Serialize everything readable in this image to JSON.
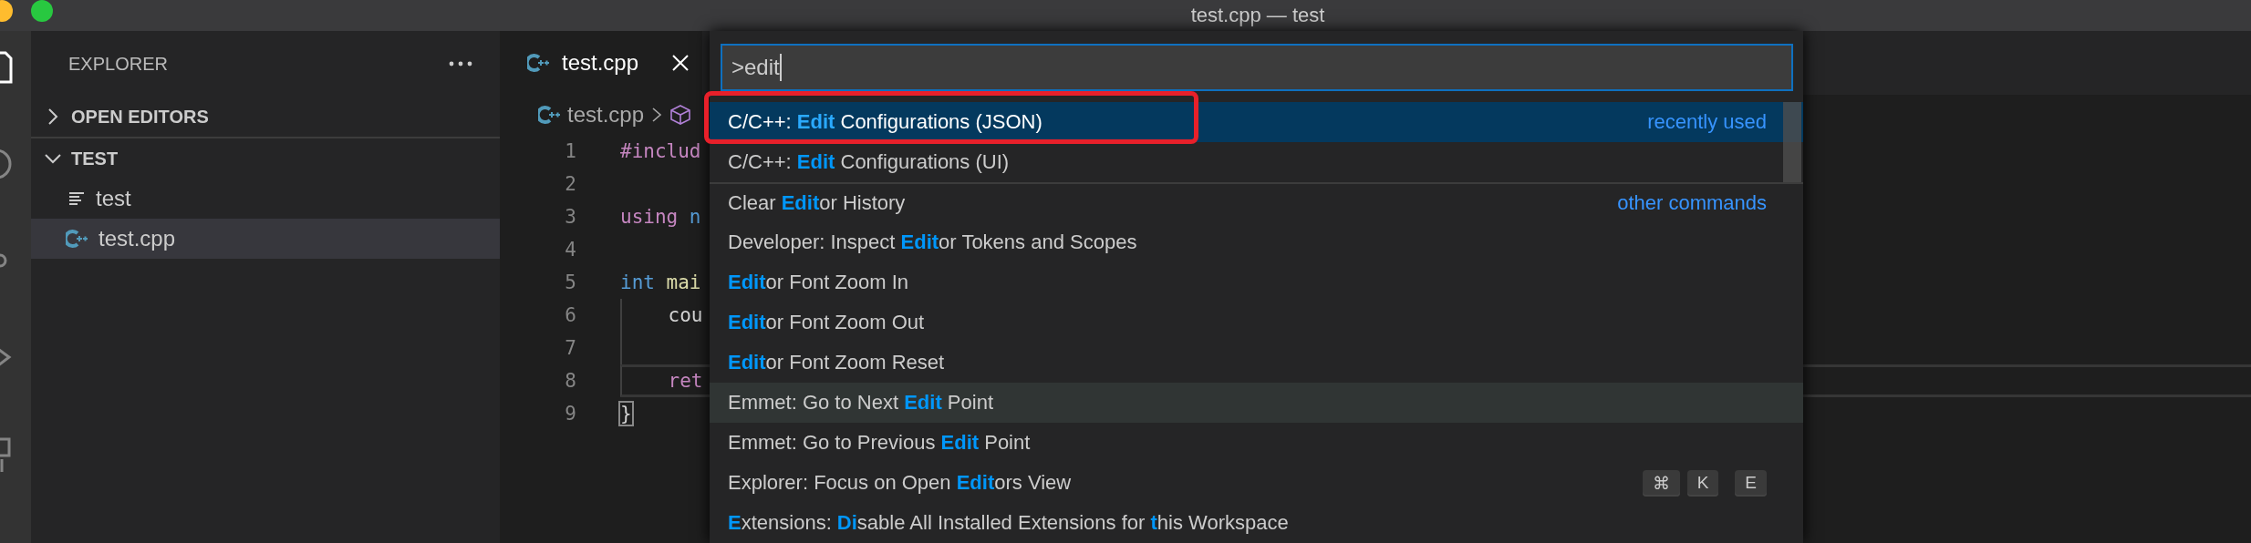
{
  "window": {
    "title": "test.cpp — test"
  },
  "sidebar": {
    "title": "EXPLORER",
    "sections": [
      {
        "label": "OPEN EDITORS",
        "expanded": false
      },
      {
        "label": "TEST",
        "expanded": true,
        "children": [
          {
            "label": "test",
            "kind": "text",
            "selected": false
          },
          {
            "label": "test.cpp",
            "kind": "cpp",
            "selected": true
          }
        ]
      }
    ]
  },
  "editor": {
    "tabs": [
      {
        "label": "test.cpp",
        "selected": true
      }
    ],
    "breadcrumb": [
      "test.cpp"
    ],
    "lines": [
      {
        "number": "1",
        "current": false,
        "tokens": [
          {
            "text": "#includ",
            "kind": "keyword"
          }
        ]
      },
      {
        "number": "2",
        "current": false
      },
      {
        "number": "3",
        "current": false,
        "tokens": [
          {
            "text": "using",
            "kind": "keyword"
          },
          {
            "text": " n",
            "kind": "type"
          }
        ]
      },
      {
        "number": "4",
        "current": false
      },
      {
        "number": "5",
        "current": false,
        "tokens": [
          {
            "text": "int",
            "kind": "type"
          },
          {
            "text": " mai",
            "kind": "function"
          }
        ]
      },
      {
        "number": "6",
        "current": false,
        "tokens": [
          {
            "text": "    cou",
            "kind": "plain"
          }
        ]
      },
      {
        "number": "7",
        "current": false
      },
      {
        "number": "8",
        "current": true,
        "tokens": [
          {
            "text": "    ret",
            "kind": "keyword"
          }
        ]
      },
      {
        "number": "9",
        "current": false,
        "tokens": [
          {
            "text": "}",
            "kind": "bracket-match"
          }
        ]
      }
    ]
  },
  "palette": {
    "value": ">edit",
    "items": [
      {
        "label": "C/C++: **Edit** Configurations (JSON)",
        "group": "recently used",
        "selected": true,
        "hovered": false,
        "annotated": true
      },
      {
        "label": "C/C++: **Edit** Configurations (UI)",
        "selected": false,
        "hovered": false,
        "annotated": false
      },
      {
        "label": "Clear **Edit**or History",
        "group": "other commands",
        "selected": false,
        "hovered": false,
        "annotated": false
      },
      {
        "label": "Developer: Inspect **Edit**or Tokens and Scopes",
        "selected": false,
        "hovered": false,
        "annotated": false
      },
      {
        "label": "**Edit**or Font Zoom In",
        "selected": false,
        "hovered": false,
        "annotated": false
      },
      {
        "label": "**Edit**or Font Zoom Out",
        "selected": false,
        "hovered": false,
        "annotated": false
      },
      {
        "label": "**Edit**or Font Zoom Reset",
        "selected": false,
        "hovered": false,
        "annotated": false
      },
      {
        "label": "Emmet: Go to Next **Edit** Point",
        "selected": false,
        "hovered": true,
        "annotated": false
      },
      {
        "label": "Emmet: Go to Previous **Edit** Point",
        "selected": false,
        "hovered": false,
        "annotated": false
      },
      {
        "label": "Explorer: Focus on Open **Edit**ors View",
        "selected": false,
        "hovered": false,
        "annotated": false,
        "keys": [
          [
            "⌘",
            "K"
          ],
          [
            "E"
          ]
        ]
      },
      {
        "label": "**E**xtensions: **Di**sable All Installed Extensions for **t**his Workspace",
        "selected": false,
        "hovered": false,
        "annotated": false
      }
    ]
  }
}
